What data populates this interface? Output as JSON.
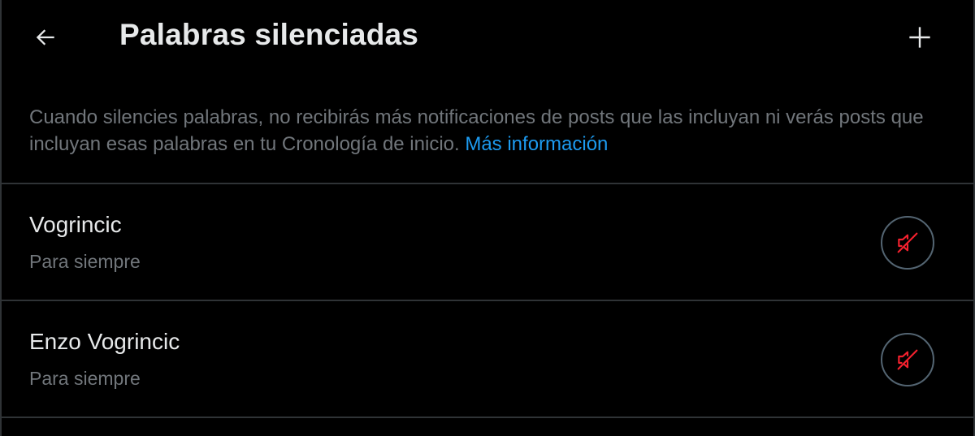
{
  "header": {
    "title": "Palabras silenciadas",
    "back_icon": "arrow-left-icon",
    "add_icon": "plus-icon"
  },
  "description": {
    "text": "Cuando silencies palabras, no recibirás más notificaciones de posts que las incluyan ni verás posts que incluyan esas palabras en tu Cronología de inicio.",
    "link_label": "Más información"
  },
  "muted_words": [
    {
      "word": "Vogrincic",
      "duration": "Para siempre",
      "action_icon": "speaker-muted-icon"
    },
    {
      "word": "Enzo Vogrincic",
      "duration": "Para siempre",
      "action_icon": "speaker-muted-icon"
    }
  ],
  "colors": {
    "background": "#000000",
    "text_primary": "#e7e9ea",
    "text_secondary": "#71767b",
    "link": "#1d9bf0",
    "border": "#2f3336",
    "unmute_icon": "#f4212e"
  }
}
